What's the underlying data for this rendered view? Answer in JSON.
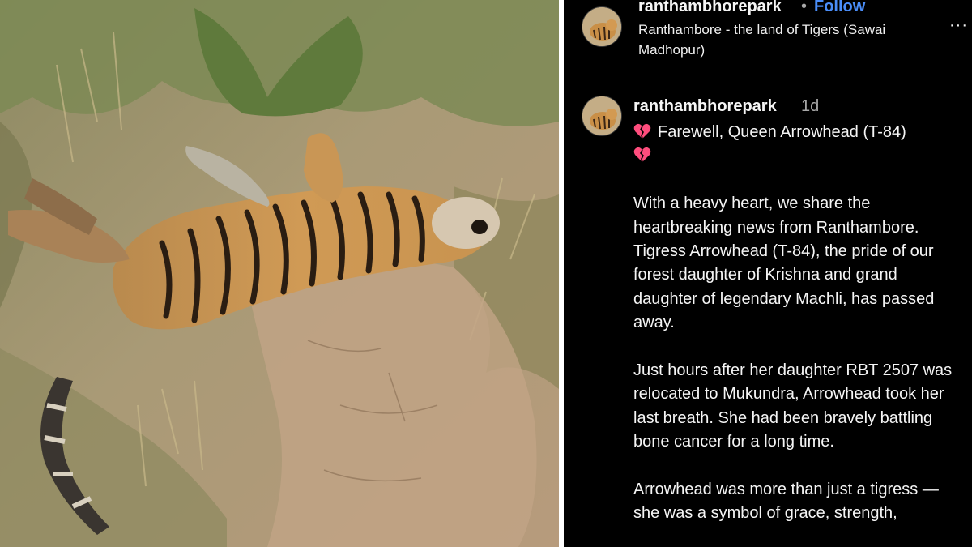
{
  "photo": {
    "alt": "",
    "icon": "tiger-photo"
  },
  "post_header": {
    "username": "ranthambhorepark",
    "separator": "•",
    "follow_label": "Follow",
    "location": "Ranthambore - the land of Tigers (Sawai Madhopur)",
    "more_icon": "more-options-icon",
    "more_label": "···"
  },
  "caption": {
    "username": "ranthambhorepark",
    "time_ago": "1d",
    "title_text": "Farewell, Queen Arrowhead (T-84)",
    "heart_icon": "broken-heart-icon",
    "paragraphs": [
      "With a heavy heart, we share the heartbreaking news from Ranthambore. Tigress Arrowhead (T-84), the pride of our forest daughter of Krishna and grand daughter of legendary Machli, has passed away.",
      "Just hours after her daughter RBT 2507 was relocated to Mukundra, Arrowhead took her last breath. She had been bravely battling bone cancer for a long time.",
      "Arrowhead was more than just a tigress — she was a symbol of grace, strength,"
    ]
  },
  "colors": {
    "panel_bg": "#000000",
    "text": "#f5f5f5",
    "muted": "#a8a8a8",
    "link": "#4a8df8",
    "heart": "#ff4d7d"
  }
}
